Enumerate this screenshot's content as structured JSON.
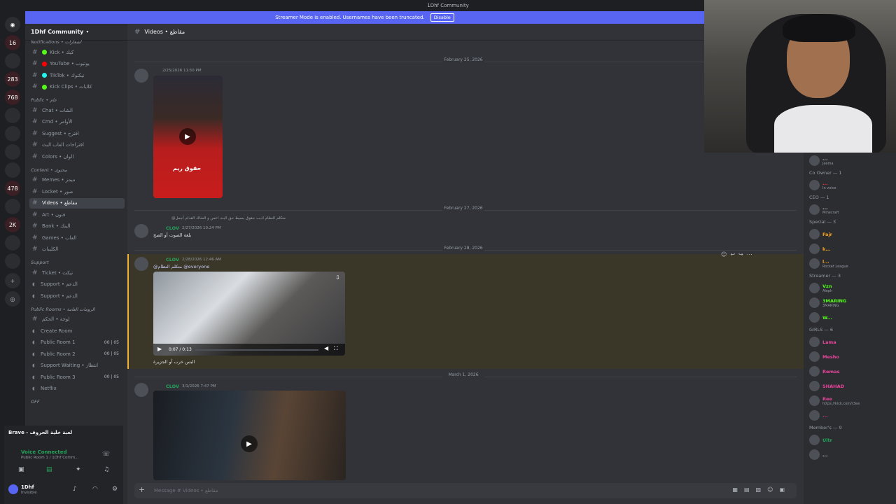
{
  "titlebar": {
    "title": "1Dhf Community"
  },
  "banner": {
    "text": "Streamer Mode is enabled. Usernames have been truncated.",
    "button": "Disable"
  },
  "server_badges": [
    "16",
    "283",
    "768",
    "478",
    "2K"
  ],
  "server": {
    "name": "1Dhf Community"
  },
  "channels": [
    {
      "label": "Notifications • اشعارات",
      "kind": "cat"
    },
    {
      "label": "Kick • كيك",
      "kind": "text",
      "dot": "#53fc18"
    },
    {
      "label": "YouTube • يوتيوب",
      "kind": "text",
      "dot": "#ff0000"
    },
    {
      "label": "TikTok • تيكتوك",
      "kind": "text",
      "dot": "#25f4ee"
    },
    {
      "label": "Kick Clips • كلابات",
      "kind": "text",
      "dot": "#53fc18"
    },
    {
      "label": "Public • عام",
      "kind": "cat"
    },
    {
      "label": "Chat • الشات",
      "kind": "text"
    },
    {
      "label": "Cmd • الأوامر",
      "kind": "text"
    },
    {
      "label": "Suggest • اقترح",
      "kind": "text"
    },
    {
      "label": "اقتراحات العاب البث",
      "kind": "text"
    },
    {
      "label": "Colors • الوان",
      "kind": "text"
    },
    {
      "label": "Content • محتوى",
      "kind": "cat"
    },
    {
      "label": "Memes • ميمز",
      "kind": "text"
    },
    {
      "label": "Locket • صور",
      "kind": "text"
    },
    {
      "label": "Videos • مقاطع",
      "kind": "text",
      "active": true
    },
    {
      "label": "Art • فنون",
      "kind": "text"
    },
    {
      "label": "Bank • البنك",
      "kind": "text"
    },
    {
      "label": "Games • العاب",
      "kind": "text"
    },
    {
      "label": "الكليبات",
      "kind": "text"
    },
    {
      "label": "Support",
      "kind": "cat"
    },
    {
      "label": "Ticket • تيكت",
      "kind": "text"
    },
    {
      "label": "Support • الدعم",
      "kind": "voice"
    },
    {
      "label": "Support • الدعم",
      "kind": "voice"
    },
    {
      "label": "Public Rooms • الرومات العامة",
      "kind": "cat"
    },
    {
      "label": "لوحة • الحكم",
      "kind": "text"
    },
    {
      "label": "Create Room",
      "kind": "voice"
    },
    {
      "label": "Public Room 1",
      "kind": "voice",
      "count": "00 | 05"
    },
    {
      "label": "Public Room 2",
      "kind": "voice",
      "count": "00 | 05"
    },
    {
      "label": "Support Waiting • انتظار",
      "kind": "voice"
    },
    {
      "label": "Public Room 3",
      "kind": "voice",
      "count": "00 | 05"
    },
    {
      "label": "Netflix",
      "kind": "voice"
    },
    {
      "label": "OFF",
      "kind": "cat"
    }
  ],
  "activity": {
    "title": "Brave - لعبة خلية الحروف"
  },
  "voice": {
    "status": "Voice Connected",
    "channel": "Public Room 1 / 1Dhf Comm..."
  },
  "user": {
    "name": "1Dhf",
    "status": "Invisible"
  },
  "header": {
    "channel": "Videos • مقاطع"
  },
  "messages": [
    {
      "date": "February 25, 2026",
      "time": "2/25/2026 11:50 PM"
    },
    {
      "date": "February 27, 2026",
      "reply": "@متكلم النظام اذبت حقوق بسيط حق البث اعس و الشاك القدام أجمل",
      "user": "CLOV",
      "time": "2/27/2026 10:24 PM",
      "text": "بلغة الصوت أو الصح"
    },
    {
      "date": "February 28, 2026",
      "user": "CLOV",
      "time": "2/28/2026 12:46 AM",
      "mention": "@متكلم النظام @everyone",
      "video_time": "0:07 / 0:13",
      "text": "البس خرب أو الجزيرة"
    },
    {
      "date": "March 1, 2026",
      "user": "CLOV",
      "time": "3/1/2026 7:47 PM"
    }
  ],
  "thumb_text": "حقوق ريم",
  "members": [
    {
      "name": "...",
      "status": "Jeema",
      "color": "#dbdee1"
    },
    {
      "cat": "Co Owner — 1"
    },
    {
      "name": "...",
      "status": "In voice",
      "color": "#ed4245"
    },
    {
      "cat": "CEO — 1"
    },
    {
      "name": "...",
      "status": "Minecraft",
      "color": "#dbdee1"
    },
    {
      "cat": "Special — 3"
    },
    {
      "name": "Fajr",
      "status": "",
      "color": "#faa61a"
    },
    {
      "name": "k...",
      "status": "",
      "color": "#faa61a"
    },
    {
      "name": "l...",
      "status": "Rocket League",
      "color": "#faa61a"
    },
    {
      "cat": "Streamer — 3"
    },
    {
      "name": "Vzn",
      "status": "Aleph",
      "color": "#53fc18"
    },
    {
      "name": "3MARING",
      "status": "3MARING",
      "color": "#53fc18"
    },
    {
      "name": "W...",
      "status": "",
      "color": "#53fc18"
    },
    {
      "cat": "GIRLS — 6"
    },
    {
      "name": "Lama",
      "status": "",
      "color": "#eb459e"
    },
    {
      "name": "Mesho",
      "status": "",
      "color": "#eb459e"
    },
    {
      "name": "Remas",
      "status": "",
      "color": "#eb459e"
    },
    {
      "name": "SHAHAD",
      "status": "",
      "color": "#eb459e"
    },
    {
      "name": "Ree",
      "status": "https://kick.com/r3ee",
      "color": "#eb459e"
    },
    {
      "name": "...",
      "status": "",
      "color": "#eb459e"
    },
    {
      "cat": "Member's — 9"
    },
    {
      "name": "Ultr",
      "status": "",
      "color": "#23a55a"
    },
    {
      "name": "...",
      "status": "",
      "color": "#dbdee1"
    }
  ],
  "composer": {
    "placeholder": "Message # Videos • مقاطع"
  }
}
